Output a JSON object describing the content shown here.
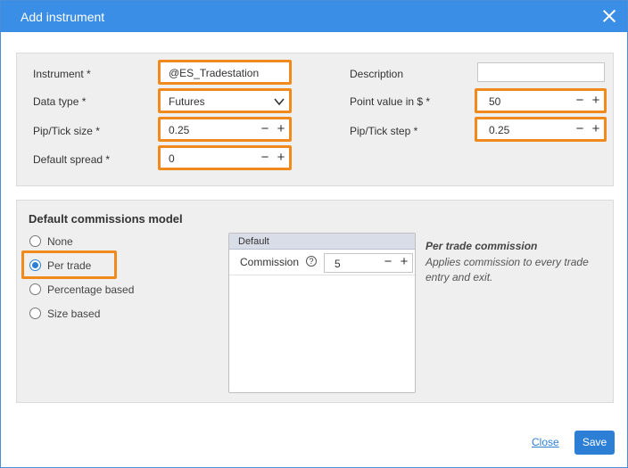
{
  "dialog": {
    "title": "Add instrument",
    "close_icon": "close-icon"
  },
  "instrument_panel": {
    "instrument": {
      "label": "Instrument *",
      "value": "@ES_Tradestation"
    },
    "data_type": {
      "label": "Data type *",
      "value": "Futures",
      "icon": "chevron-down-icon"
    },
    "pip_tick_size": {
      "label": "Pip/Tick size *",
      "value": "0.25"
    },
    "default_spread": {
      "label": "Default spread *",
      "value": "0"
    },
    "description": {
      "label": "Description",
      "value": ""
    },
    "point_value": {
      "label": "Point value in $ *",
      "value": "50"
    },
    "pip_tick_step": {
      "label": "Pip/Tick step *",
      "value": "0.25"
    },
    "stepper_minus": "−",
    "stepper_plus": "+"
  },
  "commissions": {
    "title": "Default commissions model",
    "options": [
      {
        "label": "None",
        "checked": false
      },
      {
        "label": "Per trade",
        "checked": true
      },
      {
        "label": "Percentage based",
        "checked": false
      },
      {
        "label": "Size based",
        "checked": false
      }
    ],
    "table": {
      "header": "Default",
      "commission_label": "Commission",
      "help_icon": "question-icon",
      "help_glyph": "?",
      "commission_value": "5"
    },
    "description_title": "Per trade commission",
    "description_text": "Applies commission to every trade entry and exit."
  },
  "footer": {
    "close_label": "Close",
    "save_label": "Save"
  },
  "colors": {
    "titlebar": "#3a8ee6",
    "highlight": "#f08a1c",
    "accent": "#2d7fd6",
    "panel_bg": "#efefef"
  }
}
